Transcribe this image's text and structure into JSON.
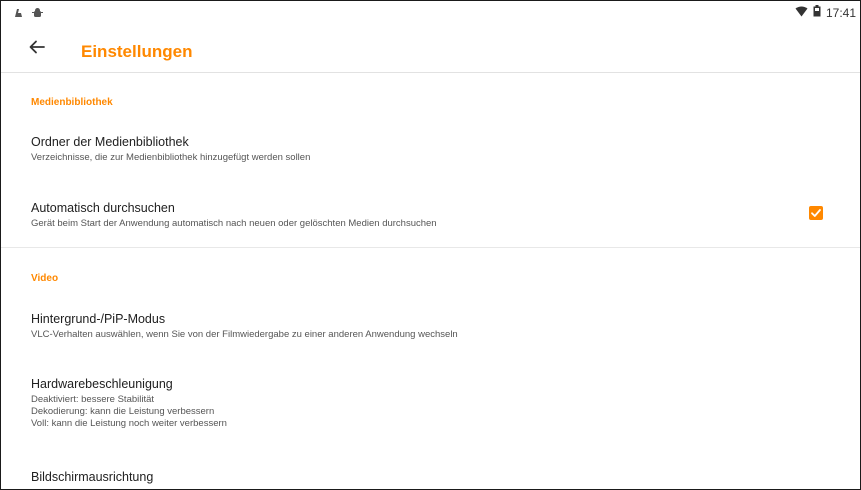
{
  "status_bar": {
    "left_icons": [
      "sd-card-icon",
      "android-debug-icon"
    ],
    "time": "17:41",
    "right_icons": [
      "wifi-icon",
      "battery-icon"
    ]
  },
  "toolbar": {
    "title": "Einstellungen"
  },
  "sections": {
    "library": {
      "title": "Medienbibliothek",
      "folders": {
        "title": "Ordner der Medienbibliothek",
        "subtitle": "Verzeichnisse, die zur Medienbibliothek hinzugefügt werden sollen"
      },
      "auto_scan": {
        "title": "Automatisch durchsuchen",
        "subtitle": "Gerät beim Start der Anwendung automatisch nach neuen oder gelöschten Medien durchsuchen",
        "checked": true
      }
    },
    "video": {
      "title": "Video",
      "background_pip": {
        "title": "Hintergrund-/PiP-Modus",
        "subtitle": "VLC-Verhalten auswählen, wenn Sie von der Filmwiedergabe zu einer anderen Anwendung wechseln"
      },
      "hw_accel": {
        "title": "Hardwarebeschleunigung",
        "lines": [
          "Deaktiviert: bessere Stabilität",
          "Dekodierung: kann die Leistung verbessern",
          "Voll: kann die Leistung noch weiter verbessern"
        ]
      },
      "orientation": {
        "title": "Bildschirmausrichtung"
      }
    }
  },
  "colors": {
    "accent": "#ff8800"
  }
}
